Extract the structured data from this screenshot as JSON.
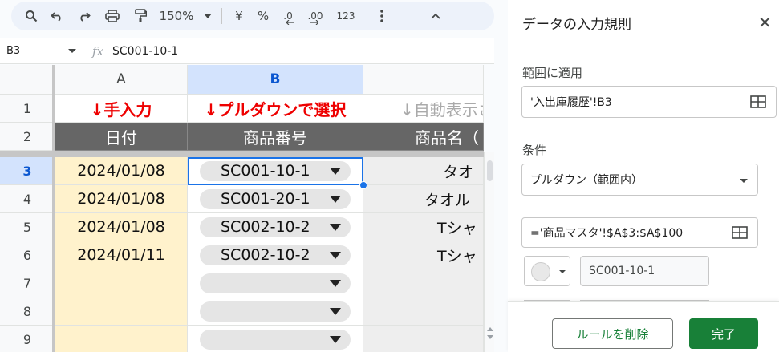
{
  "toolbar": {
    "zoom": "150%",
    "currency": "¥",
    "percent": "%",
    "dec_decrease": ".0",
    "dec_increase": ".00",
    "number_format": "123"
  },
  "formula_bar": {
    "cell_ref": "B3",
    "fx": "fx",
    "content": "SC001-10-1"
  },
  "sheet": {
    "columns": [
      "A",
      "B"
    ],
    "rows": [
      "1",
      "2",
      "3",
      "4",
      "5",
      "6",
      "7",
      "8",
      "9"
    ],
    "row1": {
      "a": "↓手入力",
      "b": "↓プルダウンで選択",
      "c": "↓自動表示さ"
    },
    "row2": {
      "a": "日付",
      "b": "商品番号",
      "c": "商品名（"
    },
    "data": [
      {
        "date": "2024/01/08",
        "code": "SC001-10-1",
        "name": "タオ"
      },
      {
        "date": "2024/01/08",
        "code": "SC001-20-1",
        "name": "タオル"
      },
      {
        "date": "2024/01/08",
        "code": "SC002-10-2",
        "name": "Tシャ"
      },
      {
        "date": "2024/01/11",
        "code": "SC002-10-2",
        "name": "Tシャ"
      },
      {
        "date": "",
        "code": "",
        "name": ""
      },
      {
        "date": "",
        "code": "",
        "name": ""
      },
      {
        "date": "",
        "code": "",
        "name": ""
      }
    ]
  },
  "panel": {
    "title": "データの入力規則",
    "close": "✕",
    "range_label": "範囲に適用",
    "range_value": "'入出庫履歴'!B3",
    "criteria_label": "条件",
    "criteria_value": "プルダウン（範囲内）",
    "formula_value": "='商品マスタ'!$A$3:$A$100",
    "item_value": "SC001-10-1",
    "remove_button": "ルールを削除",
    "done_button": "完了"
  },
  "colors": {
    "accent": "#188038",
    "selection": "#1a73e8",
    "header_dark": "#666666",
    "date_fill": "#fff2cc"
  }
}
